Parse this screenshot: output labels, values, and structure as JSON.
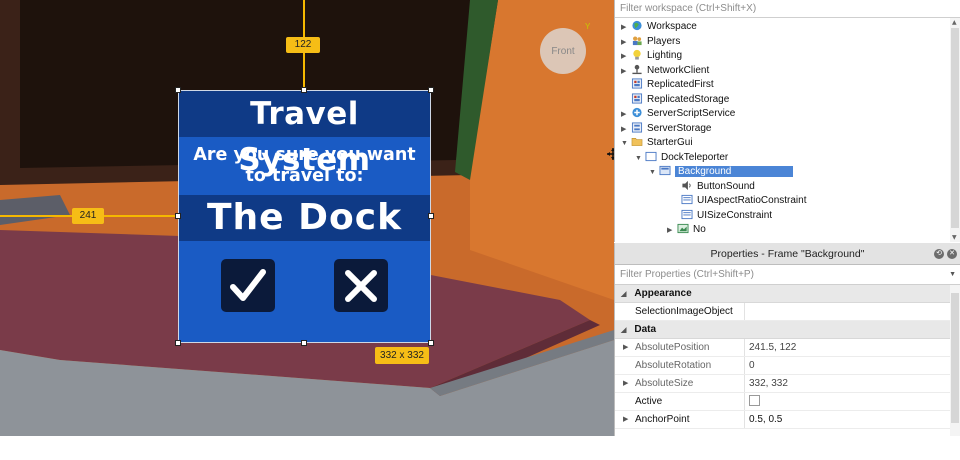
{
  "viewport": {
    "guide_x_value": "241",
    "guide_y_value": "122",
    "size_tag": "332 x 332",
    "view_cube_label": "Front",
    "axis_label": "Y"
  },
  "travel_gui": {
    "title": "Travel System",
    "question": "Are you sure you want to travel to:",
    "destination": "The Dock",
    "confirm_icon": "checkmark-icon",
    "cancel_icon": "x-icon"
  },
  "explorer": {
    "filter_placeholder": "Filter workspace (Ctrl+Shift+X)",
    "items": [
      {
        "label": "Workspace",
        "icon": "globe-icon",
        "arrow": "▶"
      },
      {
        "label": "Players",
        "icon": "players-icon",
        "arrow": "▶"
      },
      {
        "label": "Lighting",
        "icon": "lightbulb-icon",
        "arrow": "▶"
      },
      {
        "label": "NetworkClient",
        "icon": "network-icon",
        "arrow": "▶"
      },
      {
        "label": "ReplicatedFirst",
        "icon": "replicated-icon",
        "arrow": ""
      },
      {
        "label": "ReplicatedStorage",
        "icon": "replicated-storage-icon",
        "arrow": ""
      },
      {
        "label": "ServerScriptService",
        "icon": "server-script-icon",
        "arrow": "▶"
      },
      {
        "label": "ServerStorage",
        "icon": "server-storage-icon",
        "arrow": "▶"
      },
      {
        "label": "StarterGui",
        "icon": "folder-icon",
        "arrow": "▼"
      },
      {
        "label": "DockTeleporter",
        "icon": "screengui-icon",
        "arrow": "▼"
      },
      {
        "label": "Background",
        "icon": "frame-icon",
        "arrow": "▼"
      },
      {
        "label": "ButtonSound",
        "icon": "sound-icon",
        "arrow": ""
      },
      {
        "label": "UIAspectRatioConstraint",
        "icon": "constraint-icon",
        "arrow": ""
      },
      {
        "label": "UISizeConstraint",
        "icon": "constraint-icon",
        "arrow": ""
      },
      {
        "label": "No",
        "icon": "imagebutton-icon",
        "arrow": "▶"
      }
    ]
  },
  "properties": {
    "title": "Properties - Frame \"Background\"",
    "filter_placeholder": "Filter Properties (Ctrl+Shift+P)",
    "category_appearance": "Appearance",
    "selection_image_object": "SelectionImageObject",
    "category_data": "Data",
    "rows": [
      {
        "name": "AbsolutePosition",
        "value": "241.5, 122"
      },
      {
        "name": "AbsoluteRotation",
        "value": "0"
      },
      {
        "name": "AbsoluteSize",
        "value": "332, 332"
      },
      {
        "name": "Active",
        "value": ""
      },
      {
        "name": "AnchorPoint",
        "value": "0.5, 0.5"
      }
    ]
  },
  "colors": {
    "gui_blue": "#1a5bc4",
    "gui_dark_blue": "#0f3a86",
    "selection_blue": "#4b85d6",
    "guide_yellow": "#f6bd16"
  }
}
